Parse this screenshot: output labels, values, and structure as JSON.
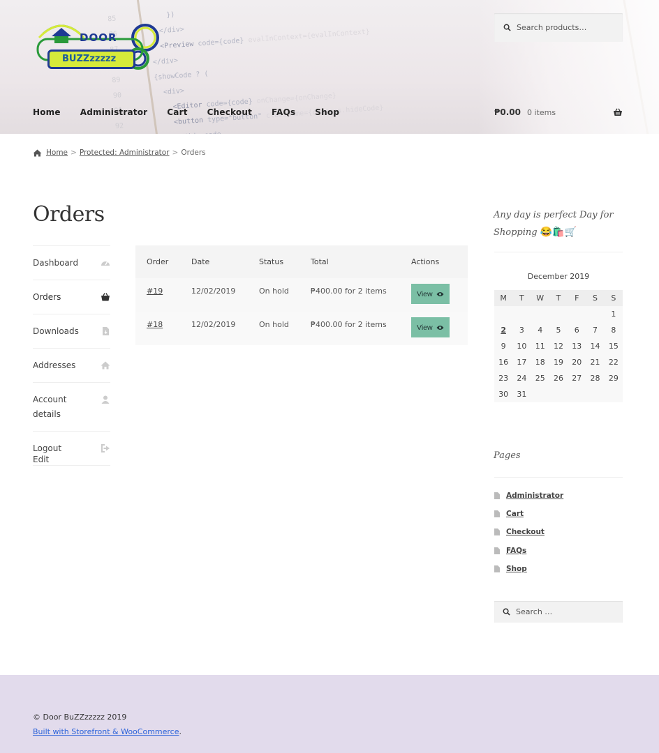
{
  "site": {
    "logo_top": "DOOR",
    "logo_bottom": "BUZZzzzzz"
  },
  "header": {
    "search_placeholder": "Search products…",
    "nav": [
      "Home",
      "Administrator",
      "Cart",
      "Checkout",
      "FAQs",
      "Shop"
    ],
    "cart_amount": "₱0.00",
    "cart_count": "0 items"
  },
  "breadcrumb": {
    "home": "Home",
    "parent": "Protected: Administrator",
    "current": "Orders",
    "separator": ">"
  },
  "page": {
    "title": "Orders"
  },
  "account_nav": {
    "items": [
      {
        "label": "Dashboard",
        "icon": "dashboard-icon"
      },
      {
        "label": "Orders",
        "icon": "basket-icon"
      },
      {
        "label": "Downloads",
        "icon": "file-download-icon"
      },
      {
        "label": "Addresses",
        "icon": "home-icon"
      },
      {
        "label": "Account details",
        "icon": "user-icon"
      },
      {
        "label": "Logout",
        "icon": "sign-out-icon"
      }
    ],
    "edit": "Edit"
  },
  "orders": {
    "headers": [
      "Order",
      "Date",
      "Status",
      "Total",
      "Actions"
    ],
    "rows": [
      {
        "order": "#19",
        "date": "12/02/2019",
        "status": "On hold",
        "total": "₱400.00 for 2 items",
        "action": "View"
      },
      {
        "order": "#18",
        "date": "12/02/2019",
        "status": "On hold",
        "total": "₱400.00 for 2 items",
        "action": "View"
      }
    ]
  },
  "sidebar": {
    "promo_text": "Any day is perfect Day for Shopping",
    "promo_emoji": "😂🛍️🛒",
    "calendar": {
      "caption": "December 2019",
      "weekdays": [
        "M",
        "T",
        "W",
        "T",
        "F",
        "S",
        "S"
      ],
      "weeks": [
        [
          "",
          "",
          "",
          "",
          "",
          "",
          "1"
        ],
        [
          "2",
          "3",
          "4",
          "5",
          "6",
          "7",
          "8"
        ],
        [
          "9",
          "10",
          "11",
          "12",
          "13",
          "14",
          "15"
        ],
        [
          "16",
          "17",
          "18",
          "19",
          "20",
          "21",
          "22"
        ],
        [
          "23",
          "24",
          "25",
          "26",
          "27",
          "28",
          "29"
        ],
        [
          "30",
          "31",
          "",
          "",
          "",
          "",
          ""
        ]
      ],
      "linked_day": "2"
    },
    "pages_title": "Pages",
    "pages": [
      "Administrator",
      "Cart",
      "Checkout",
      "FAQs",
      "Shop"
    ],
    "search_placeholder": "Search …"
  },
  "footer": {
    "copyright": "© Door BuZZzzzzz 2019",
    "built_with": "Built with Storefront & WooCommerce",
    "built_suffix": "."
  },
  "colors": {
    "view_button": "#7bbfa5",
    "footer_bg": "#e2dbec",
    "link_blue": "#2b62d9"
  }
}
